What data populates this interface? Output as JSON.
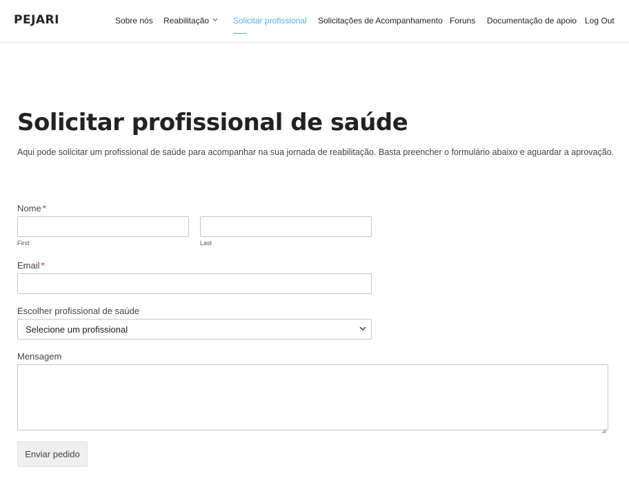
{
  "header": {
    "logo": "PEJARI",
    "nav": [
      {
        "label": "Sobre nós"
      },
      {
        "label": "Reabilitação"
      },
      {
        "label": "Solicitar profissional"
      },
      {
        "label": "Solicitações de Acompanhamento"
      },
      {
        "label": "Foruns"
      },
      {
        "label": "Documentação de apoio"
      },
      {
        "label": "Log Out"
      }
    ],
    "active_color": "#4fb3d9"
  },
  "page": {
    "title": "Solicitar profissional de saúde",
    "intro": "Aqui pode solicitar um profissional de saúde para  acompanhar na sua jornada de reabilitação. Basta preencher o formulário abaixo e aguardar a aprovação."
  },
  "form": {
    "name_label": "Nome",
    "required_mark": "*",
    "first_label": "First",
    "last_label": "Last",
    "first_value": "",
    "last_value": "",
    "email_label": "Email",
    "email_value": "",
    "professional_label": "Escolher profissional de saúde",
    "professional_selected": "Selecione um profissional",
    "message_label": "Mensagem",
    "message_value": "",
    "submit_label": "Enviar pedido"
  }
}
